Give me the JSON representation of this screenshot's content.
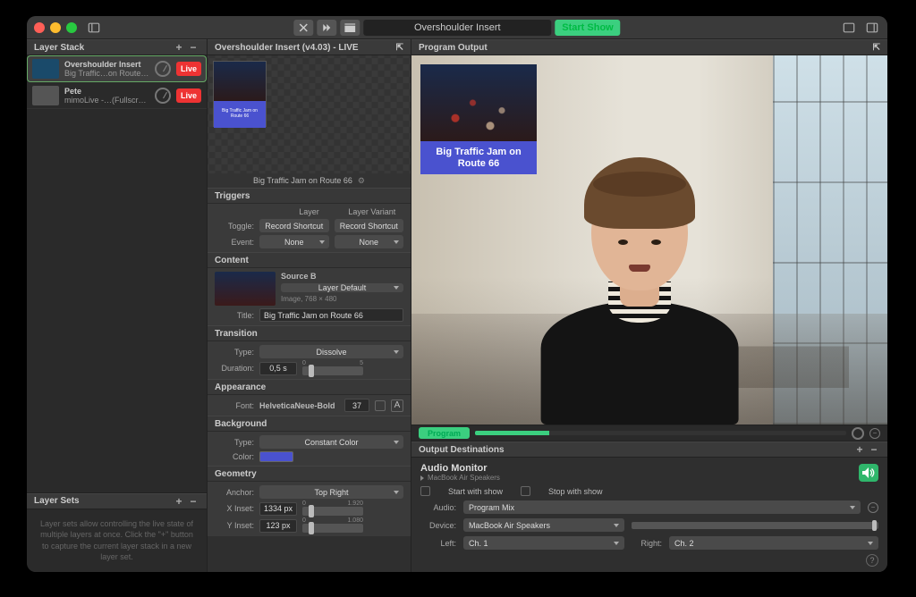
{
  "titlebar": {
    "doc_title": "Overshoulder Insert",
    "start_show": "Start Show"
  },
  "layer_stack": {
    "header": "Layer Stack",
    "items": [
      {
        "title": "Overshoulder Insert",
        "subtitle": "Big Traffic…on Route 66",
        "live": "Live",
        "selected": true
      },
      {
        "title": "Pete",
        "subtitle": "mimoLive -…(Fullscreen)",
        "live": "Live",
        "selected": false
      }
    ]
  },
  "layer_sets": {
    "header": "Layer Sets",
    "hint": "Layer sets allow controlling the live state of multiple layers at once. Click the \"+\" button to capture the current layer stack in a new layer set."
  },
  "inspector": {
    "header": "Overshoulder Insert (v4.03) - LIVE",
    "preview_caption": "Big Traffic Jam on Route 66",
    "triggers": {
      "title": "Triggers",
      "layer_col": "Layer",
      "variant_col": "Layer Variant",
      "toggle_label": "Toggle:",
      "toggle_layer": "Record Shortcut",
      "toggle_variant": "Record Shortcut",
      "event_label": "Event:",
      "event_layer": "None",
      "event_variant": "None"
    },
    "content": {
      "title": "Content",
      "source_label": "Source B",
      "source_value": "Layer Default",
      "source_size": "Image, 768 × 480",
      "title_label": "Title:",
      "title_value": "Big Traffic Jam on Route 66"
    },
    "transition": {
      "title": "Transition",
      "type_label": "Type:",
      "type_value": "Dissolve",
      "duration_label": "Duration:",
      "duration_value": "0,5 s",
      "slider_min": "0",
      "slider_max": "5"
    },
    "appearance": {
      "title": "Appearance",
      "font_label": "Font:",
      "font_name": "HelveticaNeue-Bold",
      "font_size": "37"
    },
    "background": {
      "title": "Background",
      "type_label": "Type:",
      "type_value": "Constant Color",
      "color_label": "Color:"
    },
    "geometry": {
      "title": "Geometry",
      "anchor_label": "Anchor:",
      "anchor_value": "Top Right",
      "xinset_label": "X Inset:",
      "xinset_value": "1334 px",
      "xinset_max": "1.920",
      "yinset_label": "Y Inset:",
      "yinset_value": "123 px",
      "yinset_max": "1.080"
    }
  },
  "program": {
    "header": "Program Output",
    "insert_caption": "Big Traffic Jam on Route 66",
    "program_badge": "Program"
  },
  "output_dest": {
    "header": "Output Destinations",
    "title": "Audio Monitor",
    "subtitle": "MacBook Air Speakers",
    "start_with_show": "Start with show",
    "stop_with_show": "Stop with show",
    "audio_label": "Audio:",
    "audio_value": "Program Mix",
    "device_label": "Device:",
    "device_value": "MacBook Air Speakers",
    "left_label": "Left:",
    "left_value": "Ch. 1",
    "right_label": "Right:",
    "right_value": "Ch. 2"
  }
}
